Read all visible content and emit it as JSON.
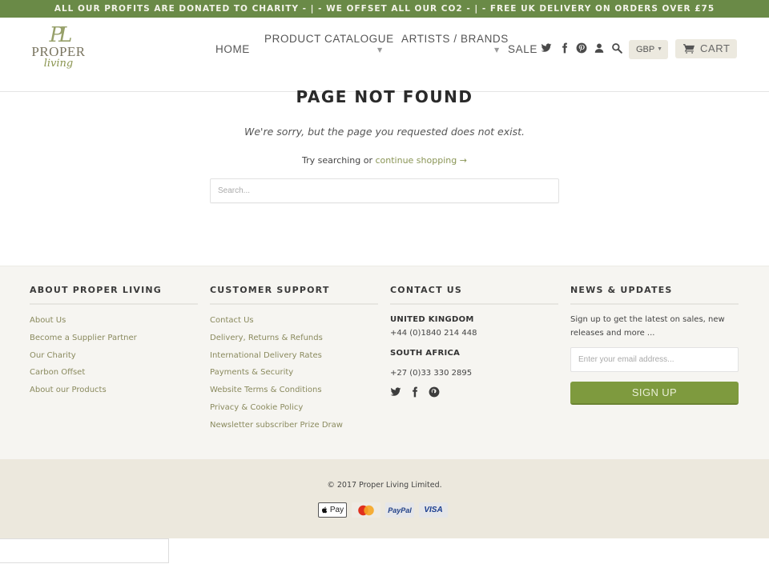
{
  "promo_bar": {
    "text": "ALL OUR PROFITS ARE DONATED TO CHARITY - | - WE OFFSET ALL OUR CO2 - | - FREE UK DELIVERY ON ORDERS OVER £75"
  },
  "brand": {
    "monogram": "PL",
    "name": "PROPER",
    "tagline": "living",
    "accent_color": "#6a8a47"
  },
  "nav": {
    "items": [
      {
        "label": "HOME",
        "has_dropdown": false
      },
      {
        "label": "PRODUCT CATALOGUE",
        "has_dropdown": true
      },
      {
        "label": "ARTISTS / BRANDS",
        "has_dropdown": true
      },
      {
        "label": "SALE",
        "has_dropdown": false
      }
    ],
    "caret": "▼",
    "icons": [
      "twitter-icon",
      "facebook-icon",
      "pinterest-icon",
      "account-icon",
      "search-icon"
    ],
    "currency": {
      "selected": "GBP",
      "caret": "▼"
    },
    "cart_label": "CART"
  },
  "main": {
    "title": "PAGE NOT FOUND",
    "message": "We're sorry, but the page you requested does not exist.",
    "try_prefix": "Try searching or ",
    "continue_link": "continue shopping →",
    "search_placeholder": "Search..."
  },
  "footer": {
    "about": {
      "heading": "ABOUT PROPER LIVING",
      "links": [
        "About Us",
        "Become a Supplier Partner",
        "Our Charity",
        "Carbon Offset",
        "About our Products"
      ]
    },
    "support": {
      "heading": "CUSTOMER SUPPORT",
      "links": [
        "Contact Us",
        "Delivery, Returns & Refunds",
        "International Delivery Rates",
        "Payments & Security",
        "Website Terms & Conditions",
        "Privacy & Cookie Policy",
        "Newsletter subscriber Prize Draw"
      ]
    },
    "contact": {
      "heading": "CONTACT US",
      "uk_label": "UNITED KINGDOM",
      "uk_phone": "+44 (0)1840 214 448",
      "sa_label": "SOUTH AFRICA",
      "sa_phone": "+27 (0)33 330 2895"
    },
    "news": {
      "heading": "NEWS & UPDATES",
      "text": "Sign up to get the latest on sales, new releases and more ...",
      "email_placeholder": "Enter your email address...",
      "button_label": "SIGN UP",
      "button_color": "#7e9a3e"
    }
  },
  "subfooter": {
    "copyright": "© 2017 Proper Living Limited.",
    "payment_methods": [
      {
        "name": "Apple Pay",
        "label": "Pay"
      },
      {
        "name": "Mastercard",
        "label": ""
      },
      {
        "name": "PayPal",
        "label": "PayPal"
      },
      {
        "name": "Visa",
        "label": "VISA"
      }
    ]
  }
}
